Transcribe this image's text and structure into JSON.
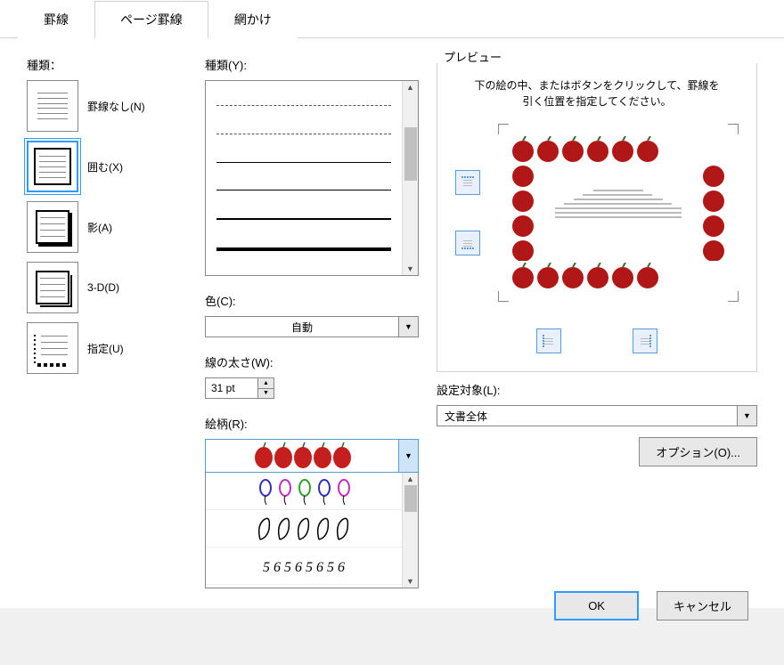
{
  "tabs": {
    "border": "罫線",
    "page_border": "ページ罫線",
    "shading": "網かけ"
  },
  "left": {
    "label": "種類：",
    "none": "罫線なし(N)",
    "box": "囲む(X)",
    "shadow": "影(A)",
    "threed": "3-D(D)",
    "custom": "指定(U)"
  },
  "mid": {
    "style_label": "種類(Y):",
    "color_label": "色(C):",
    "color_value": "自動",
    "width_label": "線の太さ(W):",
    "width_value": "31 pt",
    "art_label": "絵柄(R):"
  },
  "right": {
    "preview_label": "プレビュー",
    "hint": "下の絵の中、またはボタンをクリックして、罫線を引く位置を指定してください。",
    "apply_label": "設定対象(L):",
    "apply_value": "文書全体",
    "options": "オプション(O)..."
  },
  "buttons": {
    "ok": "OK",
    "cancel": "キャンセル"
  }
}
